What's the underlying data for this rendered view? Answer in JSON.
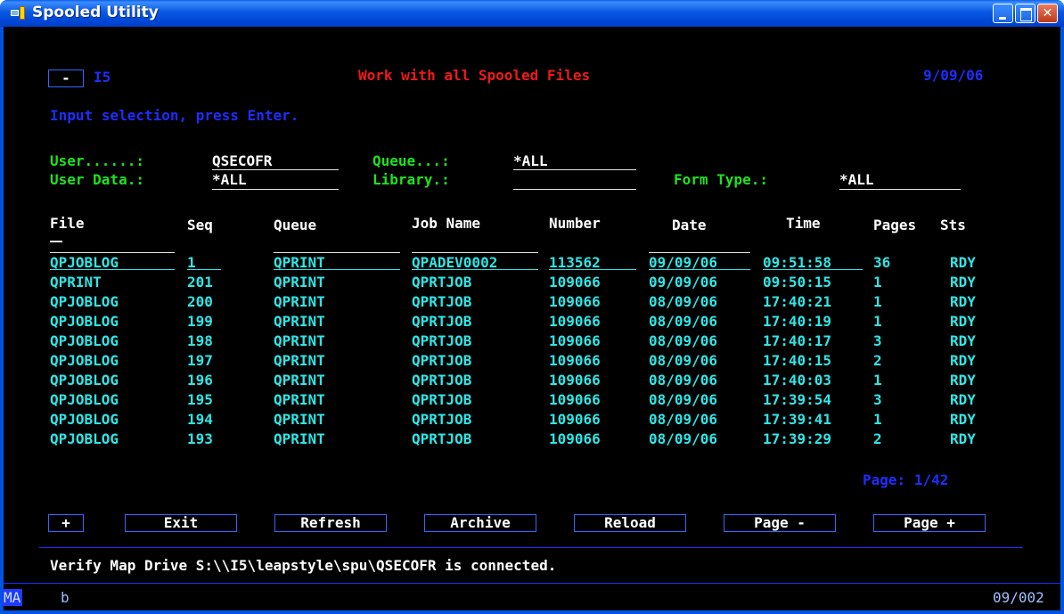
{
  "window": {
    "title": "Spooled Utility"
  },
  "header": {
    "collapse_btn": "-",
    "system": "I5",
    "title": "Work with all Spooled Files",
    "date": "9/09/06"
  },
  "instruction": "Input selection, press Enter.",
  "filters": {
    "user_label": "User......:",
    "user_value": "QSECOFR",
    "queue_label": "Queue...:",
    "queue_value": "*ALL",
    "userdata_label": "User Data.:",
    "userdata_value": "*ALL",
    "library_label": "Library.:",
    "library_value": "",
    "formtype_label": "Form Type.:",
    "formtype_value": "*ALL"
  },
  "columns": [
    "File",
    "Seq",
    "Queue",
    "Job Name",
    "Number",
    "Date",
    "Time",
    "Pages",
    "Sts"
  ],
  "rows": [
    [
      "QPJOBLOG",
      "1",
      "QPRINT",
      "QPADEV0002",
      "113562",
      "09/09/06",
      "09:51:58",
      "36",
      "RDY"
    ],
    [
      "QPRINT",
      "201",
      "QPRINT",
      "QPRTJOB",
      "109066",
      "09/09/06",
      "09:50:15",
      "1",
      "RDY"
    ],
    [
      "QPJOBLOG",
      "200",
      "QPRINT",
      "QPRTJOB",
      "109066",
      "08/09/06",
      "17:40:21",
      "1",
      "RDY"
    ],
    [
      "QPJOBLOG",
      "199",
      "QPRINT",
      "QPRTJOB",
      "109066",
      "08/09/06",
      "17:40:19",
      "1",
      "RDY"
    ],
    [
      "QPJOBLOG",
      "198",
      "QPRINT",
      "QPRTJOB",
      "109066",
      "08/09/06",
      "17:40:17",
      "3",
      "RDY"
    ],
    [
      "QPJOBLOG",
      "197",
      "QPRINT",
      "QPRTJOB",
      "109066",
      "08/09/06",
      "17:40:15",
      "2",
      "RDY"
    ],
    [
      "QPJOBLOG",
      "196",
      "QPRINT",
      "QPRTJOB",
      "109066",
      "08/09/06",
      "17:40:03",
      "1",
      "RDY"
    ],
    [
      "QPJOBLOG",
      "195",
      "QPRINT",
      "QPRTJOB",
      "109066",
      "08/09/06",
      "17:39:54",
      "3",
      "RDY"
    ],
    [
      "QPJOBLOG",
      "194",
      "QPRINT",
      "QPRTJOB",
      "109066",
      "08/09/06",
      "17:39:41",
      "1",
      "RDY"
    ],
    [
      "QPJOBLOG",
      "193",
      "QPRINT",
      "QPRTJOB",
      "109066",
      "08/09/06",
      "17:39:29",
      "2",
      "RDY"
    ]
  ],
  "page_indicator": "Page: 1/42",
  "buttons": {
    "expand": "+",
    "exit": "Exit",
    "refresh": "Refresh",
    "archive": "Archive",
    "reload": "Reload",
    "page_prev": "Page -",
    "page_next": "Page +"
  },
  "message": "Verify Map Drive S:\\\\I5\\leapstyle\\spu\\QSECOFR is connected.",
  "status": {
    "indicator": "MA",
    "cursor_char": "b",
    "position": "09/002"
  },
  "colors": {
    "green": "#1ee31e",
    "cyan": "#2ee6e6",
    "blue": "#1e2dff",
    "red": "#f01a1a",
    "white": "#ffffff"
  }
}
